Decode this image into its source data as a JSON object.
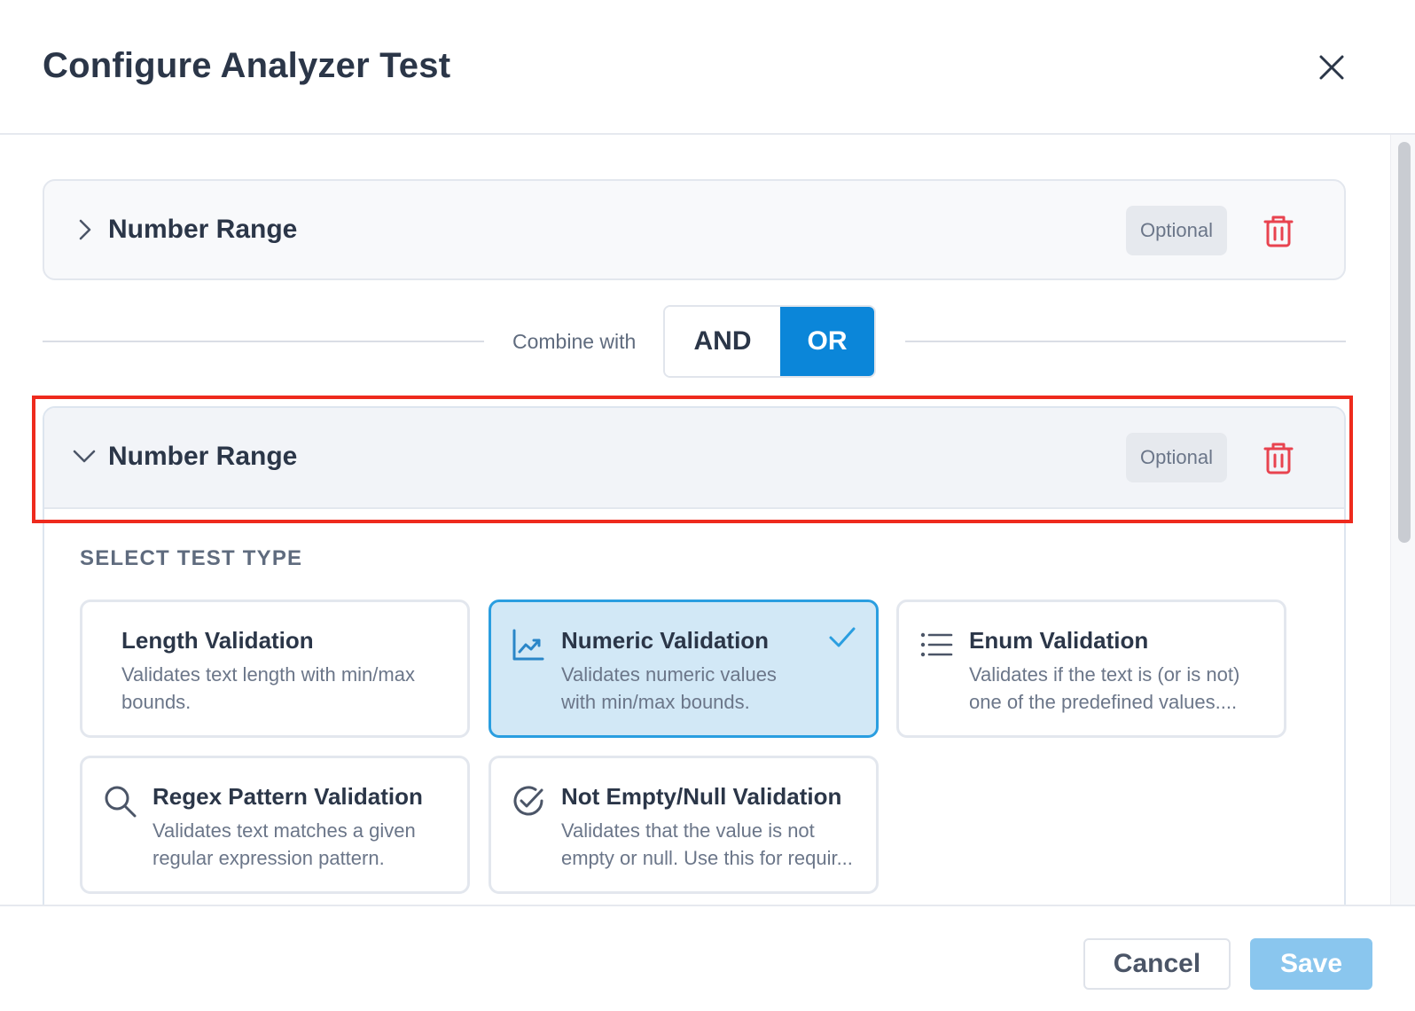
{
  "dialog": {
    "title": "Configure Analyzer Test",
    "close_icon": "close-icon"
  },
  "tests": [
    {
      "title": "Number Range",
      "badge": "Optional",
      "expanded": false,
      "chevron_icon": "chevron-right-icon",
      "delete_icon": "trash-icon"
    },
    {
      "title": "Number Range",
      "badge": "Optional",
      "expanded": true,
      "chevron_icon": "chevron-down-icon",
      "delete_icon": "trash-icon"
    }
  ],
  "combine": {
    "label": "Combine with",
    "options": [
      "AND",
      "OR"
    ],
    "selected": "OR"
  },
  "test_type": {
    "section_label": "SELECT TEST TYPE",
    "options": [
      {
        "title": "Length Validation",
        "description_lines": [
          "Validates text length with min/max",
          "bounds."
        ],
        "icon": "",
        "selected": false
      },
      {
        "title": "Numeric Validation",
        "description_lines": [
          "Validates numeric values",
          "with min/max bounds."
        ],
        "icon": "trending-chart-icon",
        "selected": true
      },
      {
        "title": "Enum Validation",
        "description_lines": [
          "Validates if the text is (or is not)",
          "one of the predefined values...."
        ],
        "icon": "list-icon",
        "selected": false
      },
      {
        "title": "Regex Pattern Validation",
        "description_lines": [
          "Validates text matches a given",
          "regular expression pattern."
        ],
        "icon": "search-icon",
        "selected": false
      },
      {
        "title": "Not Empty/Null Validation",
        "description_lines": [
          "Validates that the value is not",
          "empty or null. Use this for requir..."
        ],
        "icon": "check-circle-icon",
        "selected": false
      }
    ]
  },
  "footer": {
    "cancel_label": "Cancel",
    "save_label": "Save"
  },
  "colors": {
    "accent": "#0b86d9",
    "selected_tile_bg": "#d2e8f6",
    "delete_red": "#e8434f",
    "highlight_red": "#ee2a1d",
    "save_disabled": "#8ac6ee"
  }
}
